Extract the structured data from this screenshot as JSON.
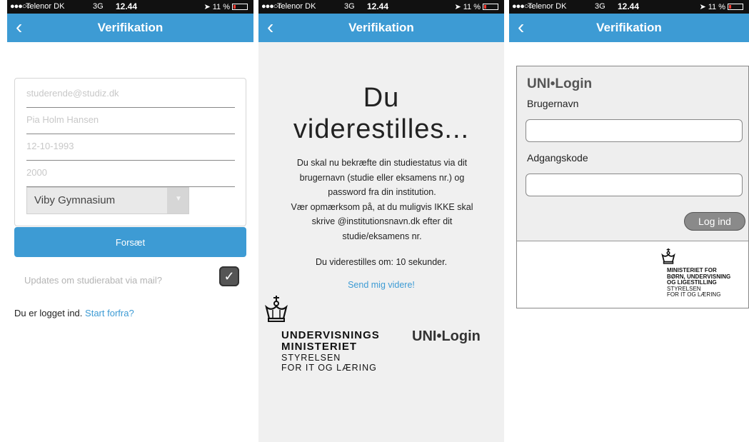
{
  "status": {
    "dots": "●●●○○",
    "carrier": "Telenor DK",
    "network": "3G",
    "time": "12.44",
    "battery": "11 %",
    "battery_level": 0.11
  },
  "screen1": {
    "nav_title": "Verifikation",
    "fields": {
      "email": "studerende@studiz.dk",
      "name": "Pia Holm Hansen",
      "birthdate": "12-10-1993",
      "zip": "2000"
    },
    "school_select": "Viby Gymnasium",
    "continue_label": "Forsæt",
    "updates_label": "Updates om studierabat via mail?",
    "updates_checked": true,
    "logged_in_text": "Du er logget ind.",
    "restart_link": "Start forfra?"
  },
  "screen2": {
    "nav_title": "Verifikation",
    "heading_line1": "Du",
    "heading_line2": "viderestilles...",
    "body_line1": "Du skal nu bekræfte din studiestatus via dit",
    "body_line2": "brugernavn (studie eller eksamens nr.) og",
    "body_line3": "password fra din institution.",
    "body_line4": "Vær opmærksom på, at du muligvis IKKE skal",
    "body_line5": "skrive @institutionsnavn.dk efter dit",
    "body_line6": "studie/eksamens nr.",
    "countdown": "Du viderestilles om: 10 sekunder.",
    "send_link": "Send mig videre!",
    "ministry_line1": "UNDERVISNINGS",
    "ministry_line2": "MINISTERIET",
    "ministry_line3": "STYRELSEN",
    "ministry_line4": "FOR IT OG LÆRING",
    "unilogin_logo": "UNI•Login"
  },
  "screen3": {
    "nav_title": "Verifikation",
    "unilogin_logo": "UNI•Login",
    "username_label": "Brugernavn",
    "password_label": "Adgangskode",
    "login_button": "Log ind",
    "ministry_line1": "MINISTERIET FOR",
    "ministry_line2": "BØRN, UNDERVISNING",
    "ministry_line3": "OG LIGESTILLING",
    "ministry_line4": "STYRELSEN",
    "ministry_line5": "FOR IT OG LÆRING"
  }
}
